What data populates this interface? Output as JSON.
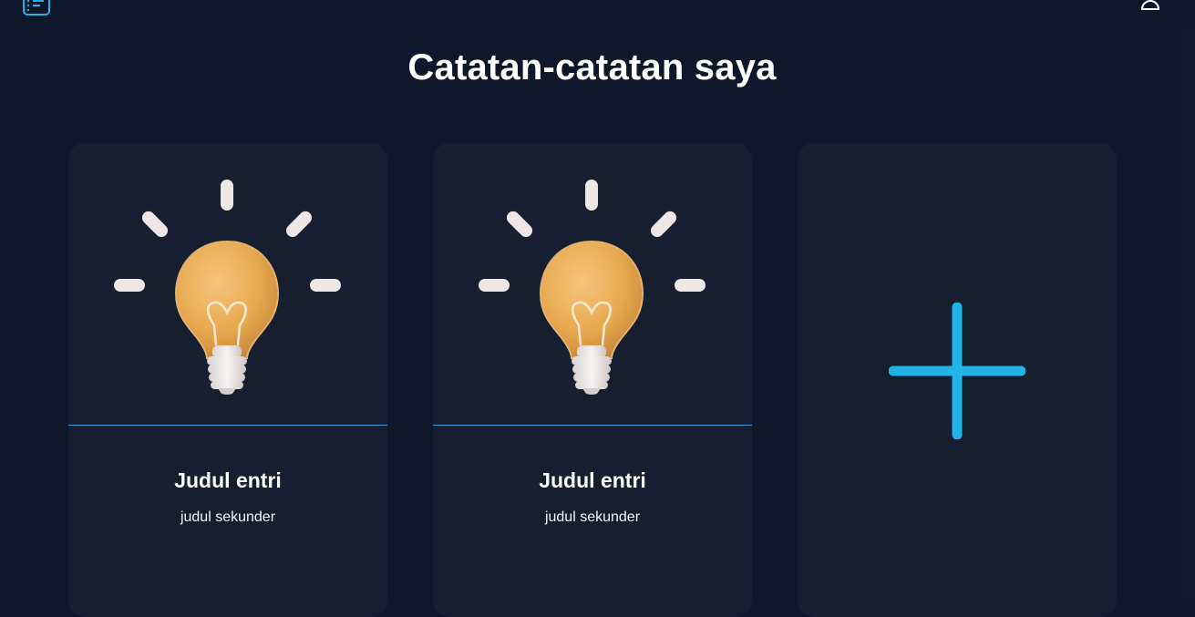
{
  "page": {
    "title": "Catatan-catatan saya"
  },
  "header": {
    "menu_icon": "list-icon",
    "user_icon": "user-icon"
  },
  "cards": [
    {
      "title": "Judul entri",
      "subtitle": "judul sekunder",
      "image": "lightbulb-icon"
    },
    {
      "title": "Judul entri",
      "subtitle": "judul sekunder",
      "image": "lightbulb-icon"
    }
  ],
  "add_card": {
    "icon": "plus-icon"
  },
  "colors": {
    "background": "#0f172a",
    "card": "#161e30",
    "accent": "#1fb3e6",
    "divider": "#3b9be0",
    "bulb": "#e7a94f"
  }
}
